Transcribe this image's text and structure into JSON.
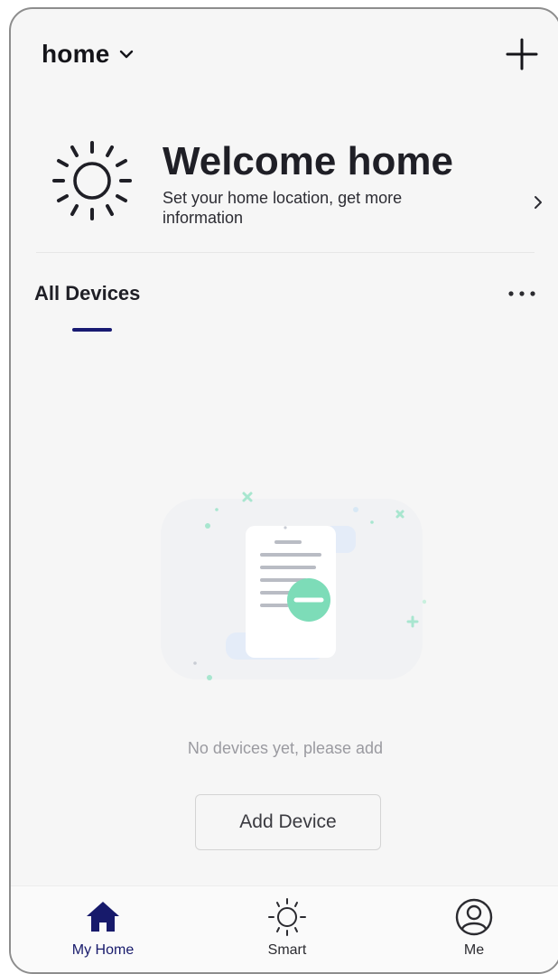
{
  "header": {
    "home_name": "home"
  },
  "welcome": {
    "title": "Welcome home",
    "subtitle": "Set your home location, get more information"
  },
  "devices": {
    "section_title": "All Devices",
    "empty_message": "No devices yet, please add",
    "add_button_label": "Add Device"
  },
  "bottom_nav": {
    "items": [
      {
        "label": "My Home",
        "icon": "home-icon",
        "active": true
      },
      {
        "label": "Smart",
        "icon": "sun-icon",
        "active": false
      },
      {
        "label": "Me",
        "icon": "user-icon",
        "active": false
      }
    ]
  },
  "colors": {
    "accent": "#171a6b",
    "illustration_green": "#7ddcb8",
    "background": "#f6f6f6"
  }
}
